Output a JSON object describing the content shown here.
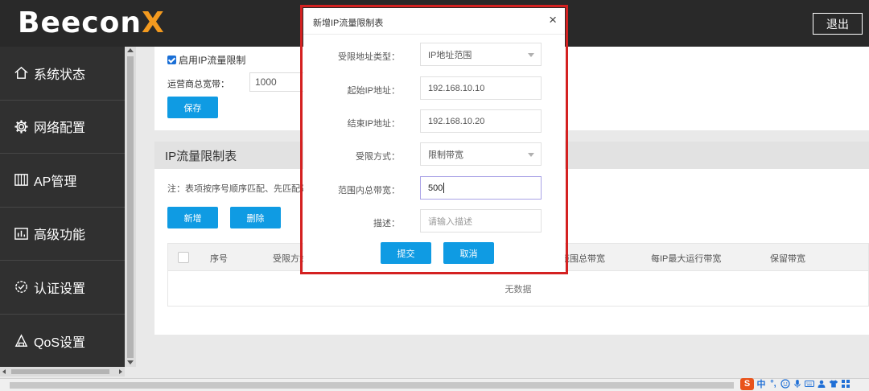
{
  "header": {
    "logo_main": "Beecon",
    "logo_accent": "X",
    "logout_label": "退出"
  },
  "sidebar": {
    "items": [
      {
        "label": "系统状态",
        "icon": "home-icon"
      },
      {
        "label": "网络配置",
        "icon": "gear-icon"
      },
      {
        "label": "AP管理",
        "icon": "ap-grid-icon"
      },
      {
        "label": "高级功能",
        "icon": "bar-chart-icon"
      },
      {
        "label": "认证设置",
        "icon": "check-circle-icon"
      },
      {
        "label": "QoS设置",
        "icon": "qos-icon"
      }
    ]
  },
  "settings": {
    "enable_label": "启用IP流量限制",
    "enable_checked": true,
    "bandwidth_label": "运营商总宽带：",
    "bandwidth_value": "1000",
    "save_label": "保存"
  },
  "list": {
    "title": "IP流量限制表",
    "note": "注：表项按序号顺序匹配、先匹配先",
    "add_label": "新增",
    "delete_label": "删除",
    "columns": [
      "序号",
      "受限方式",
      "范围总带宽",
      "每IP最大运行带宽",
      "保留带宽"
    ],
    "empty_text": "无数据"
  },
  "modal": {
    "title": "新增IP流量限制表",
    "close_symbol": "×",
    "fields": {
      "addr_type": {
        "label": "受限地址类型：",
        "value": "IP地址范围"
      },
      "start_ip": {
        "label": "起始IP地址：",
        "value": "192.168.10.10"
      },
      "end_ip": {
        "label": "结束IP地址：",
        "value": "192.168.10.20"
      },
      "limit_mode": {
        "label": "受限方式：",
        "value": "限制带宽"
      },
      "total_bw": {
        "label": "范围内总带宽：",
        "value": "500"
      },
      "description": {
        "label": "描述：",
        "placeholder": "请输入描述"
      }
    },
    "submit_label": "提交",
    "cancel_label": "取消"
  },
  "tray": {
    "ime_logo": "S",
    "ime_lang": "中",
    "ime_punct": "°,",
    "icons": [
      "emoji-icon",
      "microphone-icon",
      "keyboard-icon",
      "user-icon",
      "shirt-icon",
      "grid-menu-icon"
    ]
  },
  "colors": {
    "header_bg": "#292929",
    "sidebar_bg": "#303030",
    "button_blue": "#0f9be3",
    "logo_accent": "#f39a1f",
    "highlight_red": "#d42121"
  }
}
